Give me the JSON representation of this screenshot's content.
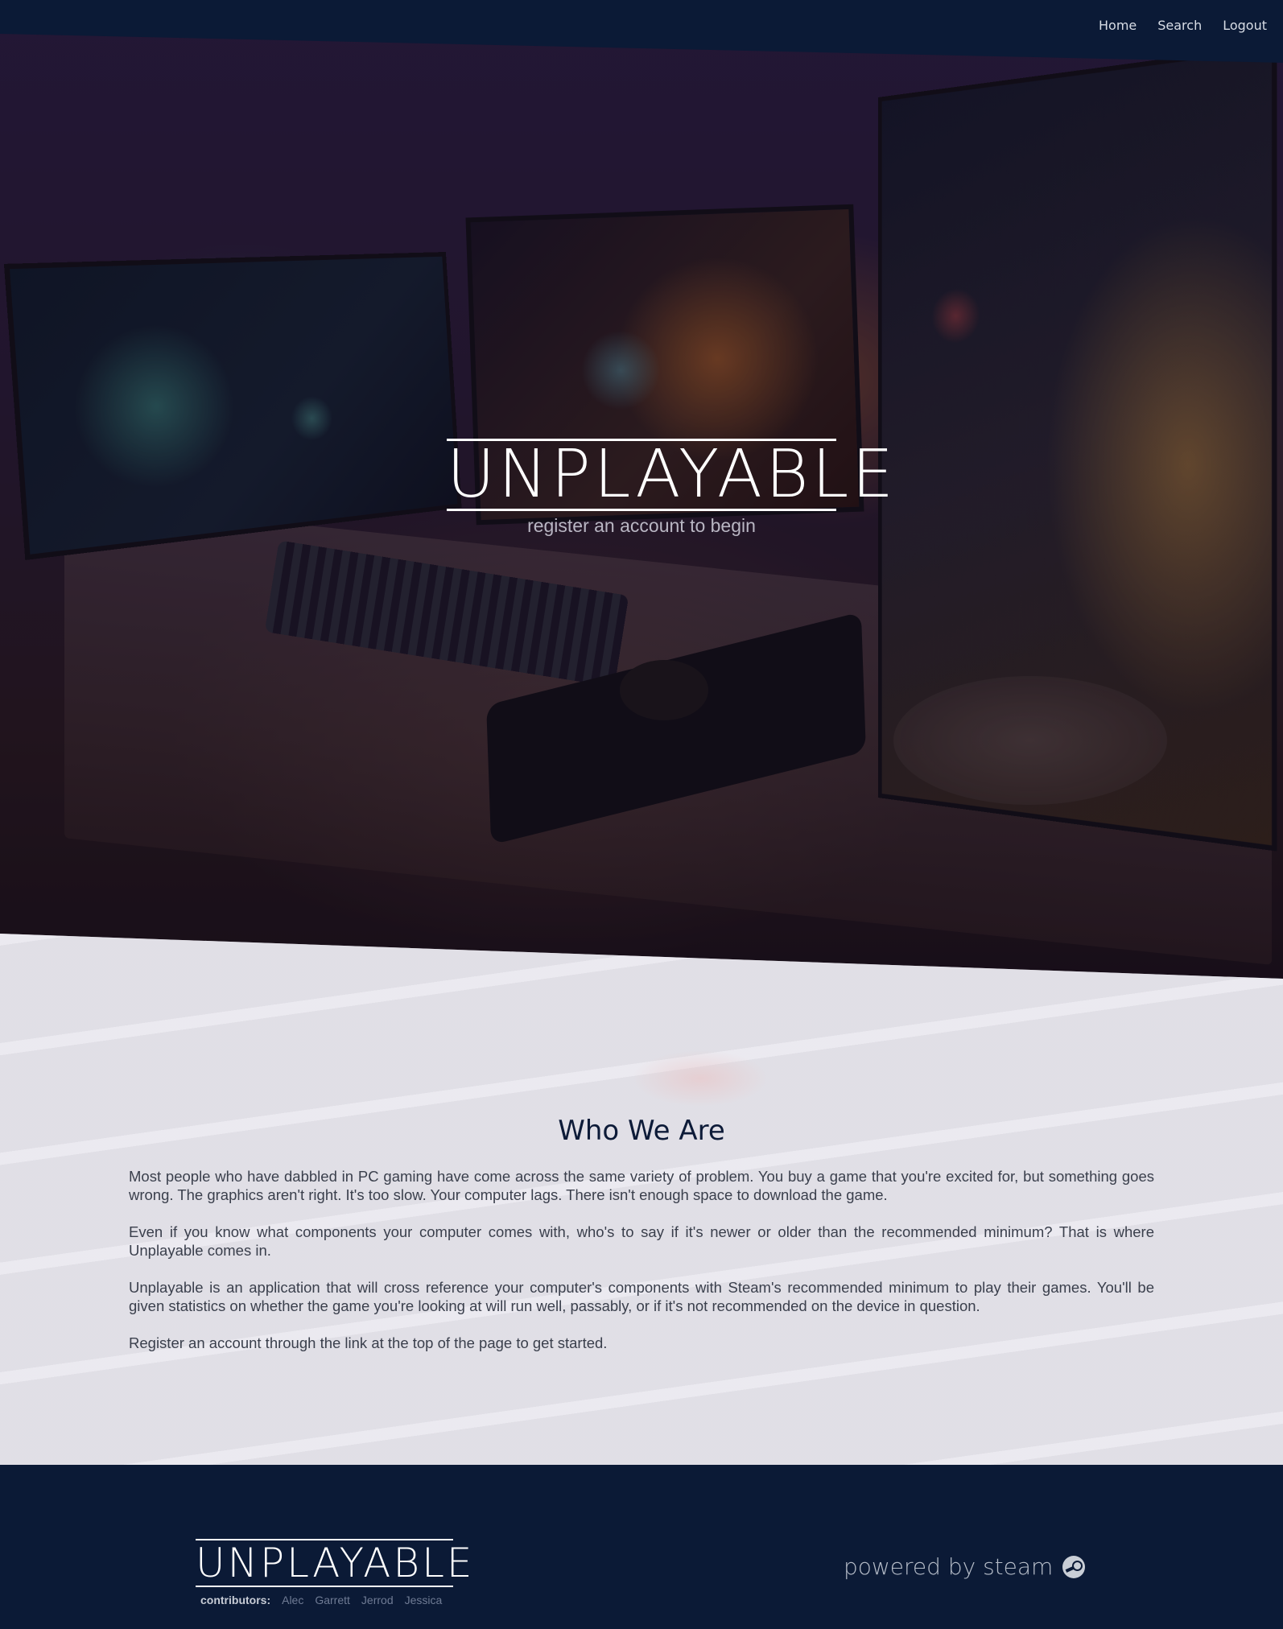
{
  "nav": {
    "home": "Home",
    "search": "Search",
    "logout": "Logout"
  },
  "hero": {
    "logo": "UNPLAYABLE",
    "tagline": "register an account to begin"
  },
  "about": {
    "title": "Who We Are",
    "paragraphs": [
      "Most people who have dabbled in PC gaming have come across the same variety of problem. You buy a game that you're excited for, but something goes wrong. The graphics aren't right. It's too slow. Your computer lags. There isn't enough space to download the game.",
      "Even if you know what components your computer comes with, who's to say if it's newer or older than the recommended minimum? That is where Unplayable comes in.",
      "Unplayable is an application that will cross reference your computer's components with Steam's recommended minimum to play their games. You'll be given statistics on whether the game you're looking at will run well, passably, or if it's not recommended on the device in question.",
      "Register an account through the link at the top of the page to get started."
    ]
  },
  "footer": {
    "logo": "UNPLAYABLE",
    "contributors_label": "contributors:",
    "contributors": [
      "Alec",
      "Garrett",
      "Jerrod",
      "Jessica"
    ],
    "powered_by": "powered by steam",
    "steam_icon": "steam-icon"
  },
  "colors": {
    "navy": "#0b1a36",
    "about_bg": "#efedf2",
    "heading": "#0d1b38"
  }
}
